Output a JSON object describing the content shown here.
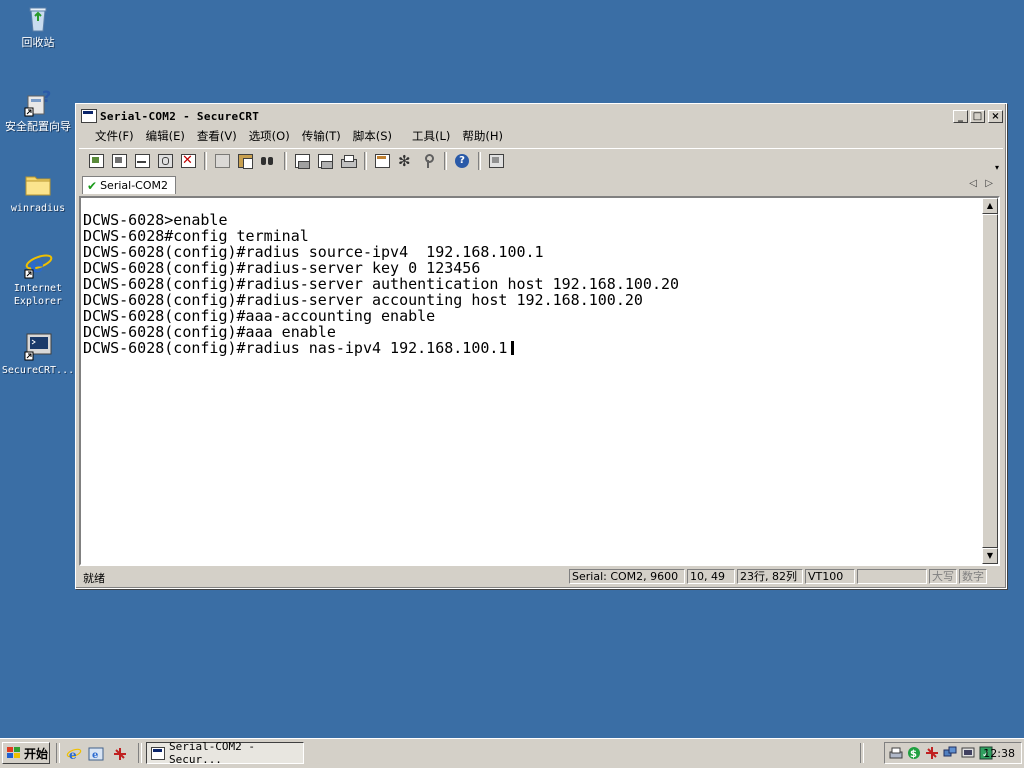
{
  "desktop": {
    "icons": [
      {
        "label": "回收站",
        "icon": "recycle-bin-icon"
      },
      {
        "label": "安全配置向导",
        "icon": "security-wizard-icon"
      },
      {
        "label": "winradius",
        "icon": "folder-icon"
      },
      {
        "label": "Internet Explorer",
        "icon": "internet-explorer-icon"
      },
      {
        "label": "SecureCRT...",
        "icon": "securecrt-shortcut-icon"
      }
    ]
  },
  "window": {
    "title": "Serial-COM2 - SecureCRT",
    "controls": {
      "minimize": "_",
      "maximize": "□",
      "close": "×"
    },
    "menu": [
      "文件(F)",
      "编辑(E)",
      "查看(V)",
      "选项(O)",
      "传输(T)",
      "脚本(S)",
      "工具(L)",
      "帮助(H)"
    ],
    "tab": {
      "label": "Serial-COM2"
    },
    "terminal_lines": [
      "DCWS-6028>enable",
      "DCWS-6028#config terminal",
      "DCWS-6028(config)#radius source-ipv4  192.168.100.1",
      "DCWS-6028(config)#radius-server key 0 123456",
      "DCWS-6028(config)#radius-server authentication host 192.168.100.20",
      "DCWS-6028(config)#radius-server accounting host 192.168.100.20",
      "DCWS-6028(config)#aaa-accounting enable",
      "DCWS-6028(config)#aaa enable",
      "DCWS-6028(config)#radius nas-ipv4 192.168.100.1"
    ],
    "status": {
      "ready": "就绪",
      "connection": "Serial: COM2, 9600",
      "cursor_pos": "10, 49",
      "size": "23行, 82列",
      "emulation": "VT100",
      "blank": "",
      "caps": "大写",
      "num": "数字"
    }
  },
  "taskbar": {
    "start_label": "开始",
    "task_button": "Serial-COM2 - Secur...",
    "clock": "12:38"
  },
  "colors": {
    "desktop": "#3a6ea5",
    "window_face": "#d4d0c8",
    "terminal_bg": "#ffffff",
    "terminal_fg": "#000000"
  }
}
